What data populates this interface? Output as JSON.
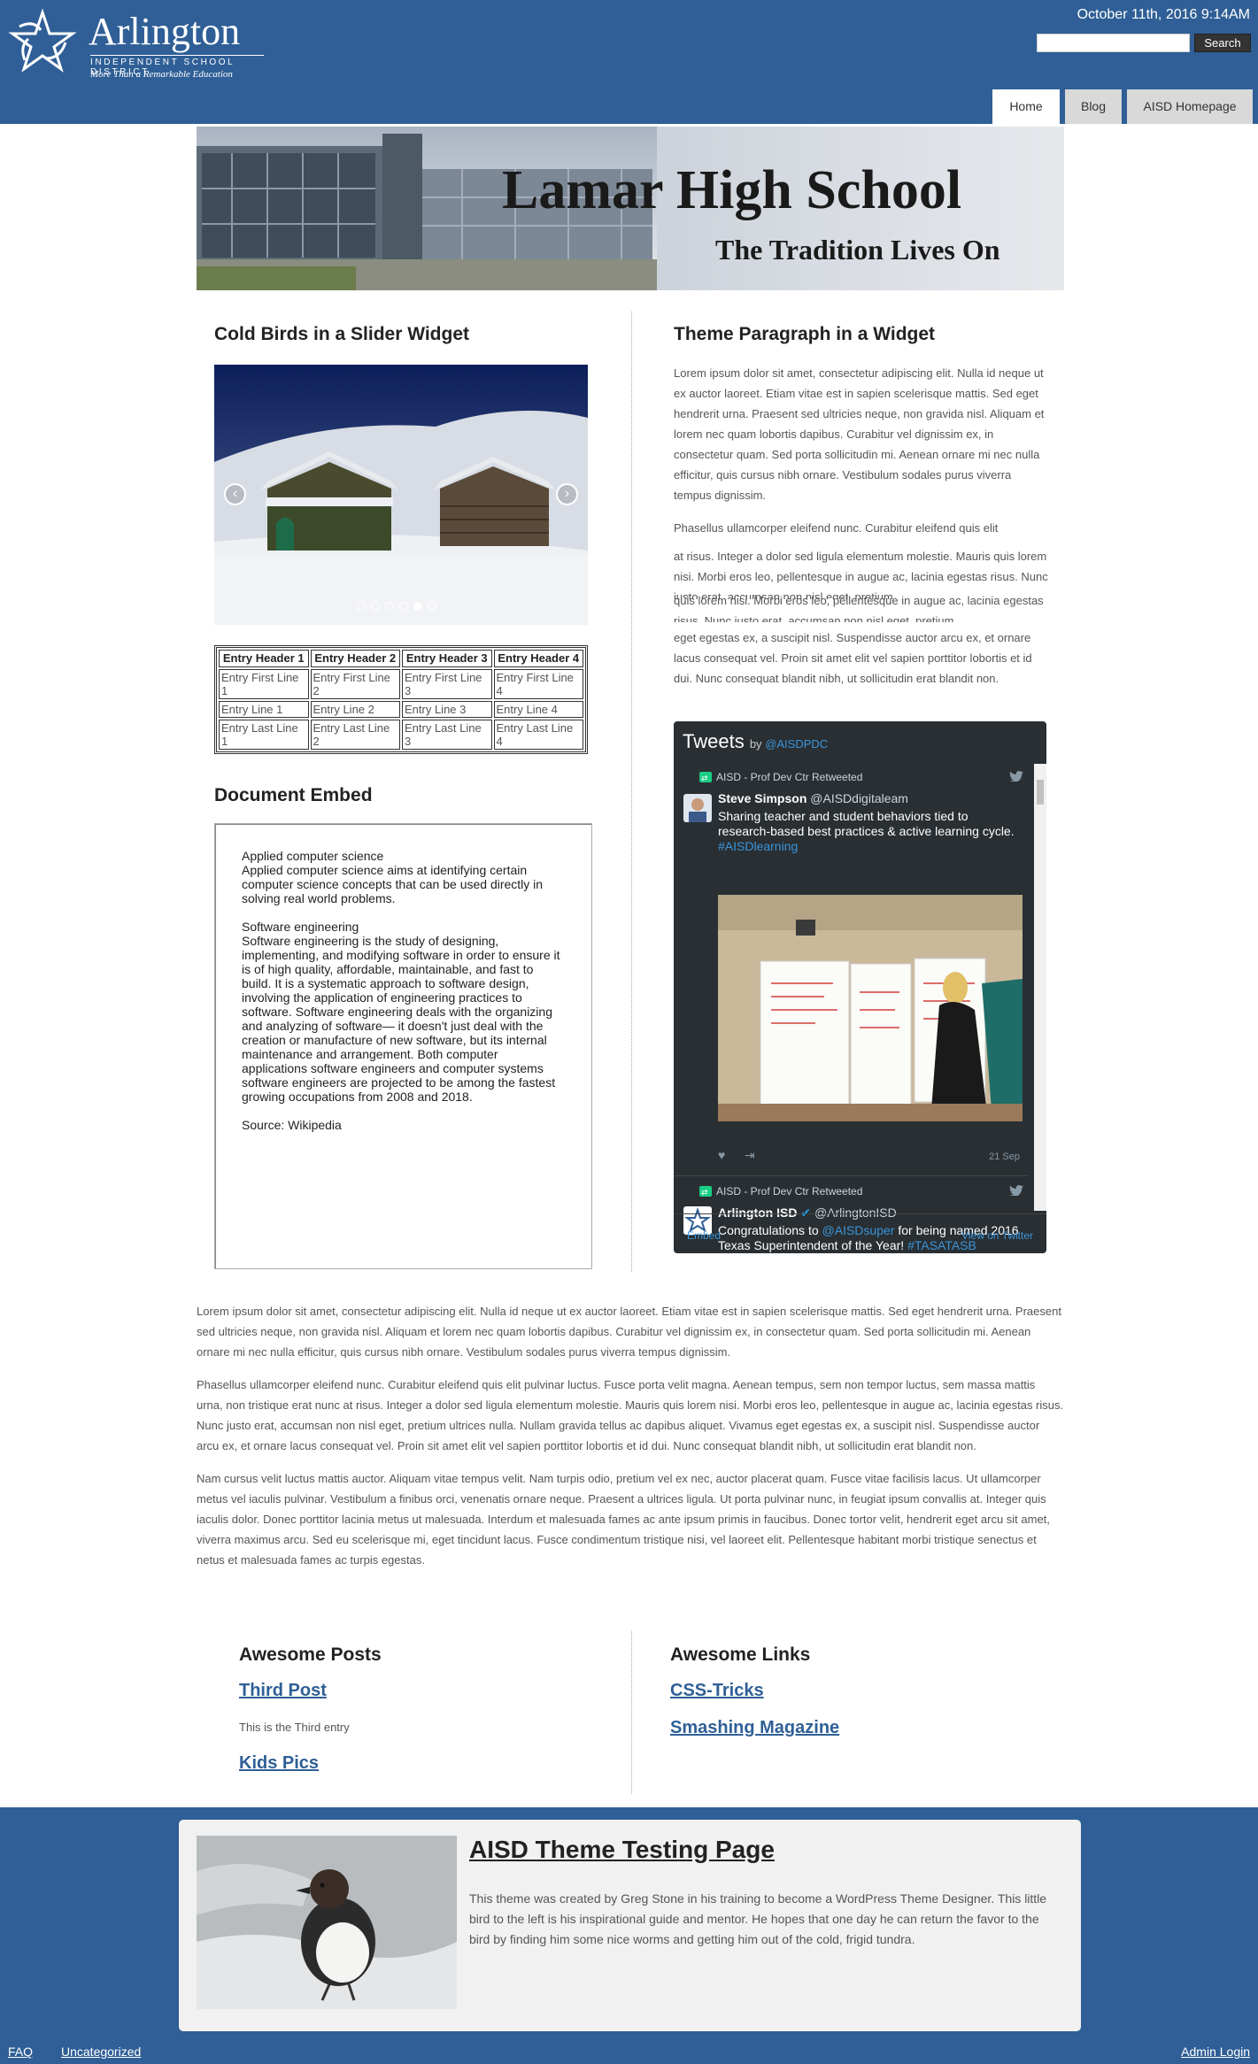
{
  "header": {
    "logo": {
      "name": "Arlington",
      "district": "INDEPENDENT SCHOOL DISTRICT",
      "tagline": "More Than a Remarkable Education"
    },
    "datetime": "October 11th, 2016 9:14AM",
    "search": {
      "placeholder": "",
      "value": "",
      "button_label": "Search"
    },
    "nav": [
      {
        "label": "Home",
        "active": true
      },
      {
        "label": "Blog",
        "active": false
      },
      {
        "label": "AISD Homepage",
        "active": false
      }
    ]
  },
  "banner": {
    "title": "Lamar High School",
    "subtitle": "The Tradition Lives On"
  },
  "left_column": {
    "slider_title": "Cold Birds in a Slider Widget",
    "slider": {
      "prev_glyph": "‹",
      "next_glyph": "›",
      "dot_count": 6,
      "active_dot": 5
    },
    "table": {
      "headers": [
        "Entry Header 1",
        "Entry Header 2",
        "Entry Header 3",
        "Entry Header 4"
      ],
      "rows": [
        [
          "Entry First Line 1",
          "Entry First Line 2",
          "Entry First Line 3",
          "Entry First Line 4"
        ],
        [
          "Entry Line 1",
          "Entry Line 2",
          "Entry Line 3",
          "Entry Line 4"
        ],
        [
          "Entry Last Line 1",
          "Entry Last Line 2",
          "Entry Last Line 3",
          "Entry Last Line 4"
        ]
      ]
    },
    "document_title": "Document Embed",
    "document": {
      "p1_title": "Applied computer science",
      "p1_body": "Applied computer science aims at identifying certain computer science concepts that can be used directly in solving real world problems.",
      "p2_title": "Software engineering",
      "p2_body": "Software engineering is the study of designing, implementing, and modifying software in order to ensure it is of high quality, affordable, maintainable, and fast to build. It is a systematic approach to software design, involving the application of engineering practices to software. Software engineering deals with the organizing and analyzing of software— it doesn't just deal with the creation or manufacture of new software, but its internal maintenance and arrangement. Both computer applications software engineers and computer systems software engineers are projected to be among the fastest growing occupations from 2008 and 2018.",
      "source": "Source: Wikipedia"
    }
  },
  "right_column": {
    "theme_title": "Theme Paragraph in a Widget",
    "theme_p1": "Lorem ipsum dolor sit amet, consectetur adipiscing elit. Nulla id neque ut ex auctor laoreet. Etiam vitae est in sapien scelerisque mattis. Sed eget hendrerit urna. Praesent sed ultricies neque, non gravida nisl. Aliquam et lorem nec quam lobortis dapibus. Curabitur vel dignissim ex, in consectetur quam. Sed porta sollicitudin mi. Aenean ornare mi nec nulla efficitur, quis cursus nibh ornare. Vestibulum sodales purus viverra tempus dignissim.",
    "theme_p2_start": "Phasellus ullamcorper eleifend nunc. Curabitur eleifend quis elit",
    "overlap_a": "at risus. Integer a dolor sed ligula elementum molestie. Mauris quis lorem nisi. Morbi eros leo, pellentesque in augue ac, lacinia egestas risus. Nunc justo erat, accumsan non nisl eget, pretium",
    "overlap_b": "quis lorem nisi. Morbi eros leo, pellentesque in augue ac, lacinia egestas risus. Nunc justo erat, accumsan non nisl eget, pretium",
    "overlap_c": "eget egestas ex, a suscipit nisl. Suspendisse auctor arcu ex, et ornare lacus consequat vel. Proin sit amet elit vel sapien porttitor lobortis et id dui. Nunc consequat blandit nibh, ut sollicitudin erat blandit non."
  },
  "twitter": {
    "title": "Tweets",
    "by": "by",
    "handle": "@AISDPDC",
    "tweets": [
      {
        "retweeted_by": "AISD - Prof Dev Ctr Retweeted",
        "name": "Steve Simpson",
        "handle": "@AISDdigitaleam",
        "text": "Sharing teacher and student behaviors tied to research-based best practices & active learning cycle.",
        "hashtag": "#AISDlearning",
        "date": "21 Sep"
      },
      {
        "retweeted_by": "AISD - Prof Dev Ctr Retweeted",
        "name": "Arlington ISD",
        "handle": "@ArlingtonISD",
        "text_pre": "Congratulations to",
        "mention": "@AISDsuper",
        "text_post": "for being named 2016 Texas Superintendent of the Year!",
        "hashtag": "#TASATASB"
      }
    ],
    "embed_label": "Embed",
    "view_label": "View on Twitter"
  },
  "body": {
    "p1": "Lorem ipsum dolor sit amet, consectetur adipiscing elit. Nulla id neque ut ex auctor laoreet. Etiam vitae est in sapien scelerisque mattis. Sed eget hendrerit urna. Praesent sed ultricies neque, non gravida nisl. Aliquam et lorem nec quam lobortis dapibus. Curabitur vel dignissim ex, in consectetur quam. Sed porta sollicitudin mi. Aenean ornare mi nec nulla efficitur, quis cursus nibh ornare. Vestibulum sodales purus viverra tempus dignissim.",
    "p2": "Phasellus ullamcorper eleifend nunc. Curabitur eleifend quis elit pulvinar luctus. Fusce porta velit magna. Aenean tempus, sem non tempor luctus, sem massa mattis urna, non tristique erat nunc at risus. Integer a dolor sed ligula elementum molestie. Mauris quis lorem nisi. Morbi eros leo, pellentesque in augue ac, lacinia egestas risus. Nunc justo erat, accumsan non nisl eget, pretium ultrices nulla. Nullam gravida tellus ac dapibus aliquet. Vivamus eget egestas ex, a suscipit nisl. Suspendisse auctor arcu ex, et ornare lacus consequat vel. Proin sit amet elit vel sapien porttitor lobortis et id dui. Nunc consequat blandit nibh, ut sollicitudin erat blandit non.",
    "p3": "Nam cursus velit luctus mattis auctor. Aliquam vitae tempus velit. Nam turpis odio, pretium vel ex nec, auctor placerat quam. Fusce vitae facilisis lacus. Ut ullamcorper metus vel iaculis pulvinar. Vestibulum a finibus orci, venenatis ornare neque. Praesent a ultrices ligula. Ut porta pulvinar nunc, in feugiat ipsum convallis at. Integer quis iaculis dolor. Donec porttitor lacinia metus ut malesuada. Interdum et malesuada fames ac ante ipsum primis in faucibus. Donec tortor velit, hendrerit eget arcu sit amet, viverra maximus arcu. Sed eu scelerisque mi, eget tincidunt lacus. Fusce condimentum tristique nisi, vel laoreet elit. Pellentesque habitant morbi tristique senectus et netus et malesuada fames ac turpis egestas."
  },
  "posts": {
    "title": "Awesome Posts",
    "items": [
      {
        "label": "Third Post",
        "desc": "This is the Third entry"
      },
      {
        "label": "Kids Pics"
      }
    ]
  },
  "links": {
    "title": "Awesome Links",
    "items": [
      {
        "label": "CSS-Tricks"
      },
      {
        "label": "Smashing Magazine"
      }
    ]
  },
  "footer": {
    "title": "AISD Theme Testing Page",
    "text": "This theme was created by Greg Stone in his training to become a WordPress Theme Designer. This little bird to the left is his inspirational guide and mentor. He hopes that one day he can return the favor to the bird by finding him some nice worms and getting him out of the cold, frigid tundra.",
    "links": {
      "faq": "FAQ",
      "uncategorized": "Uncategorized",
      "admin": "Admin Login"
    }
  },
  "colors": {
    "brand_blue": "#2f5f96",
    "twitter_bg": "#292f33",
    "twitter_link": "#3b94d9"
  }
}
